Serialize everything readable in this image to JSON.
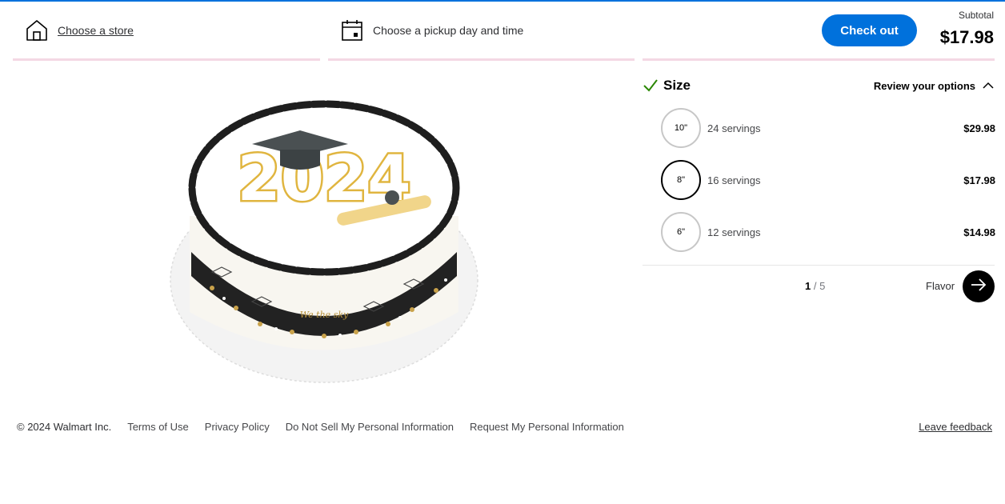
{
  "header": {
    "store_label": "Choose a store",
    "pickup_label": "Choose a pickup day and time",
    "checkout_label": "Check out",
    "subtotal_label": "Subtotal",
    "subtotal_value": "$17.98"
  },
  "cake_image": {
    "text": "2024",
    "text_on_side": "We the sky"
  },
  "options": {
    "section_title": "Size",
    "review_label": "Review your options",
    "sizes": [
      {
        "size": "10\"",
        "servings": "24 servings",
        "price": "$29.98",
        "selected": false
      },
      {
        "size": "8\"",
        "servings": "16 servings",
        "price": "$17.98",
        "selected": true
      },
      {
        "size": "6\"",
        "servings": "12 servings",
        "price": "$14.98",
        "selected": false
      }
    ],
    "pager_current": "1",
    "pager_sep": "/",
    "pager_total": "5",
    "next_label": "Flavor"
  },
  "footer": {
    "copyright": "© 2024 Walmart Inc.",
    "links": [
      "Terms of Use",
      "Privacy Policy",
      "Do Not Sell My Personal Information",
      "Request My Personal Information"
    ],
    "feedback": "Leave feedback"
  },
  "colors": {
    "brand_blue": "#0071dc",
    "progress_pink": "#f4d8e4",
    "check_green": "#2a8703"
  },
  "icons": [
    "store-icon",
    "calendar-icon",
    "checkmark-icon",
    "chevron-up-icon",
    "arrow-right-icon"
  ]
}
